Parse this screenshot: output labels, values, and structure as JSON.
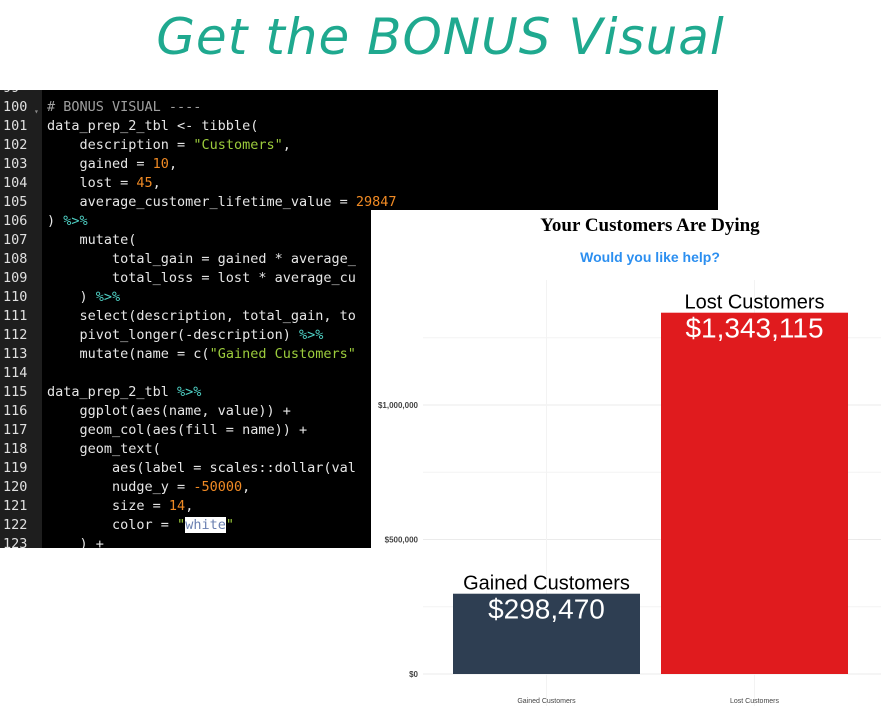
{
  "headline": "Get the BONUS Visual",
  "editor": {
    "lines": [
      {
        "n": "99",
        "tokens": []
      },
      {
        "n": "100",
        "tokens": [
          [
            "# BONUS VISUAL ----",
            "comment"
          ]
        ]
      },
      {
        "n": "101",
        "tokens": [
          [
            "data_prep_2_tbl <- tibble(",
            "plain"
          ]
        ]
      },
      {
        "n": "102",
        "tokens": [
          [
            "    description = ",
            "plain"
          ],
          [
            "\"Customers\"",
            "string"
          ],
          [
            ",",
            "plain"
          ]
        ]
      },
      {
        "n": "103",
        "tokens": [
          [
            "    gained = ",
            "plain"
          ],
          [
            "10",
            "number"
          ],
          [
            ",",
            "plain"
          ]
        ]
      },
      {
        "n": "104",
        "tokens": [
          [
            "    lost = ",
            "plain"
          ],
          [
            "45",
            "number"
          ],
          [
            ",",
            "plain"
          ]
        ]
      },
      {
        "n": "105",
        "tokens": [
          [
            "    average_customer_lifetime_value = ",
            "plain"
          ],
          [
            "29847",
            "number"
          ]
        ]
      },
      {
        "n": "106",
        "tokens": [
          [
            ") ",
            "plain"
          ],
          [
            "%>%",
            "op"
          ]
        ]
      },
      {
        "n": "107",
        "tokens": [
          [
            "    mutate(",
            "plain"
          ]
        ]
      },
      {
        "n": "108",
        "tokens": [
          [
            "        total_gain = gained * average_",
            "plain"
          ]
        ]
      },
      {
        "n": "109",
        "tokens": [
          [
            "        total_loss = lost * average_cu",
            "plain"
          ]
        ]
      },
      {
        "n": "110",
        "tokens": [
          [
            "    ) ",
            "plain"
          ],
          [
            "%>%",
            "op"
          ]
        ]
      },
      {
        "n": "111",
        "tokens": [
          [
            "    select(description, total_gain, to",
            "plain"
          ]
        ]
      },
      {
        "n": "112",
        "tokens": [
          [
            "    pivot_longer(-description) ",
            "plain"
          ],
          [
            "%>%",
            "op"
          ]
        ]
      },
      {
        "n": "113",
        "tokens": [
          [
            "    mutate(name = c(",
            "plain"
          ],
          [
            "\"Gained Customers\"",
            "string"
          ]
        ]
      },
      {
        "n": "114",
        "tokens": []
      },
      {
        "n": "115",
        "tokens": [
          [
            "data_prep_2_tbl ",
            "plain"
          ],
          [
            "%>%",
            "op"
          ]
        ]
      },
      {
        "n": "116",
        "tokens": [
          [
            "    ggplot(aes(name, value)) +",
            "plain"
          ]
        ]
      },
      {
        "n": "117",
        "tokens": [
          [
            "    geom_col(aes(fill = name)) +",
            "plain"
          ]
        ]
      },
      {
        "n": "118",
        "tokens": [
          [
            "    geom_text(",
            "plain"
          ]
        ]
      },
      {
        "n": "119",
        "tokens": [
          [
            "        aes(label = scales::dollar(val",
            "plain"
          ]
        ]
      },
      {
        "n": "120",
        "tokens": [
          [
            "        nudge_y = ",
            "plain"
          ],
          [
            "-50000",
            "number"
          ],
          [
            ",",
            "plain"
          ]
        ]
      },
      {
        "n": "121",
        "tokens": [
          [
            "        size = ",
            "plain"
          ],
          [
            "14",
            "number"
          ],
          [
            ",",
            "plain"
          ]
        ]
      },
      {
        "n": "122",
        "tokens": [
          [
            "        color = ",
            "plain"
          ],
          [
            "\"",
            "string"
          ],
          [
            "white",
            "hl"
          ],
          [
            "\"",
            "string"
          ]
        ]
      },
      {
        "n": "123",
        "tokens": [
          [
            "    ) +",
            "plain"
          ]
        ]
      }
    ]
  },
  "chart_data": {
    "type": "bar",
    "title": "Your Customers Are Dying",
    "subtitle": "Would you like help?",
    "categories": [
      "Gained Customers",
      "Lost Customers"
    ],
    "values": [
      298470,
      1343115
    ],
    "bar_labels": [
      "$298,470",
      "$1,343,115"
    ],
    "ylim": [
      0,
      1400000
    ],
    "yticks": [
      0,
      500000,
      1000000
    ],
    "ytick_labels": [
      "$0",
      "$500,000",
      "$1,000,000"
    ],
    "grid": true,
    "colors": {
      "Gained Customers": "#2e3e52",
      "Lost Customers": "#e01b1e",
      "title": "#000000",
      "subtitle": "#2c8ff0"
    }
  }
}
